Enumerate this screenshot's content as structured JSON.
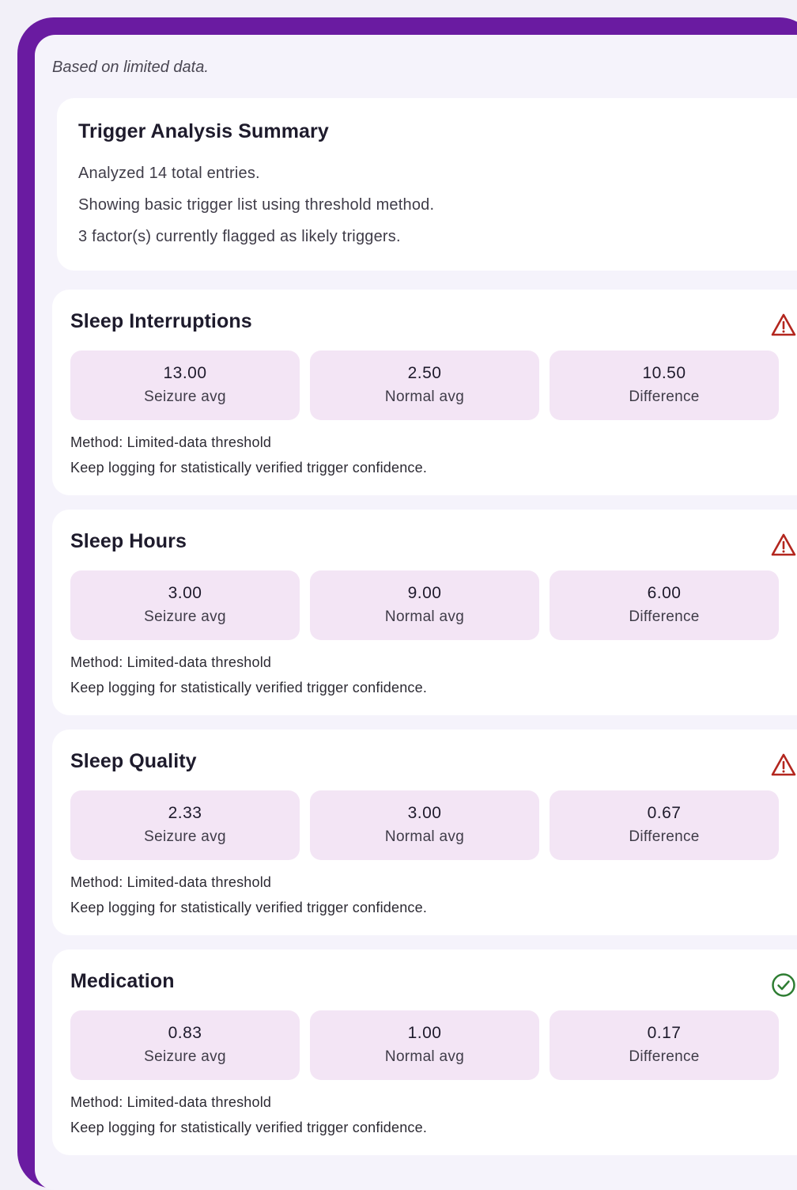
{
  "note": "Based on limited data.",
  "summary": {
    "title": "Trigger Analysis Summary",
    "lines": [
      "Analyzed 14 total entries.",
      "Showing basic trigger list using threshold method.",
      "3 factor(s) currently flagged as likely triggers."
    ]
  },
  "colors": {
    "frame": "#6a1ba1",
    "stat_box": "#f3e5f5",
    "warning": "#b3261e",
    "ok": "#2e7d32"
  },
  "triggers": [
    {
      "title": "Sleep Interruptions",
      "status_icon": "warning-icon",
      "stats": [
        {
          "value": "13.00",
          "label": "Seizure avg"
        },
        {
          "value": "2.50",
          "label": "Normal avg"
        },
        {
          "value": "10.50",
          "label": "Difference"
        }
      ],
      "method": "Method: Limited-data threshold",
      "hint": "Keep logging for statistically verified trigger confidence."
    },
    {
      "title": "Sleep Hours",
      "status_icon": "warning-icon",
      "stats": [
        {
          "value": "3.00",
          "label": "Seizure avg"
        },
        {
          "value": "9.00",
          "label": "Normal avg"
        },
        {
          "value": "6.00",
          "label": "Difference"
        }
      ],
      "method": "Method: Limited-data threshold",
      "hint": "Keep logging for statistically verified trigger confidence."
    },
    {
      "title": "Sleep Quality",
      "status_icon": "warning-icon",
      "stats": [
        {
          "value": "2.33",
          "label": "Seizure avg"
        },
        {
          "value": "3.00",
          "label": "Normal avg"
        },
        {
          "value": "0.67",
          "label": "Difference"
        }
      ],
      "method": "Method: Limited-data threshold",
      "hint": "Keep logging for statistically verified trigger confidence."
    },
    {
      "title": "Medication",
      "status_icon": "check-circle-icon",
      "stats": [
        {
          "value": "0.83",
          "label": "Seizure avg"
        },
        {
          "value": "1.00",
          "label": "Normal avg"
        },
        {
          "value": "0.17",
          "label": "Difference"
        }
      ],
      "method": "Method: Limited-data threshold",
      "hint": "Keep logging for statistically verified trigger confidence."
    }
  ]
}
